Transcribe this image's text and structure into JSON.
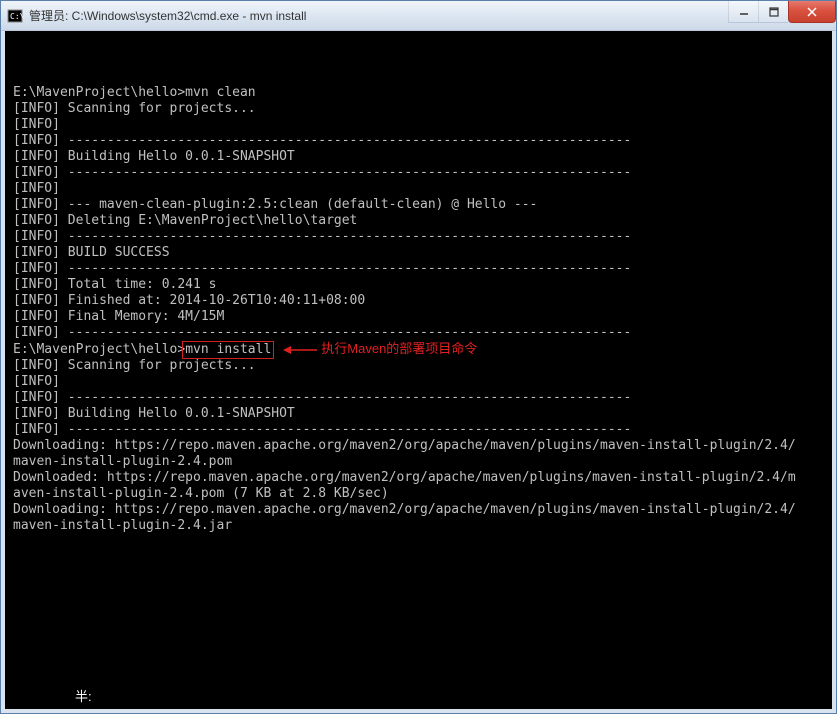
{
  "window": {
    "title": "管理员: C:\\Windows\\system32\\cmd.exe - mvn  install"
  },
  "terminal": {
    "lines": [
      "",
      "E:\\MavenProject\\hello>mvn clean",
      "[INFO] Scanning for projects...",
      "[INFO]",
      "[INFO] ------------------------------------------------------------------------",
      "[INFO] Building Hello 0.0.1-SNAPSHOT",
      "[INFO] ------------------------------------------------------------------------",
      "[INFO]",
      "[INFO] --- maven-clean-plugin:2.5:clean (default-clean) @ Hello ---",
      "[INFO] Deleting E:\\MavenProject\\hello\\target",
      "[INFO] ------------------------------------------------------------------------",
      "[INFO] BUILD SUCCESS",
      "[INFO] ------------------------------------------------------------------------",
      "[INFO] Total time: 0.241 s",
      "[INFO] Finished at: 2014-10-26T10:40:11+08:00",
      "[INFO] Final Memory: 4M/15M",
      "[INFO] ------------------------------------------------------------------------",
      "",
      "[INFO] Scanning for projects...",
      "[INFO]",
      "[INFO] ------------------------------------------------------------------------",
      "[INFO] Building Hello 0.0.1-SNAPSHOT",
      "[INFO] ------------------------------------------------------------------------",
      "Downloading: https://repo.maven.apache.org/maven2/org/apache/maven/plugins/maven-install-plugin/2.4/",
      "maven-install-plugin-2.4.pom",
      "Downloaded: https://repo.maven.apache.org/maven2/org/apache/maven/plugins/maven-install-plugin/2.4/m",
      "aven-install-plugin-2.4.pom (7 KB at 2.8 KB/sec)",
      "Downloading: https://repo.maven.apache.org/maven2/org/apache/maven/plugins/maven-install-plugin/2.4/",
      "maven-install-plugin-2.4.jar"
    ],
    "prompt_line": {
      "prompt": "E:\\MavenProject\\hello>",
      "command": "mvn install"
    },
    "annotation": "执行Maven的部署项目命令",
    "ime": "半:"
  }
}
